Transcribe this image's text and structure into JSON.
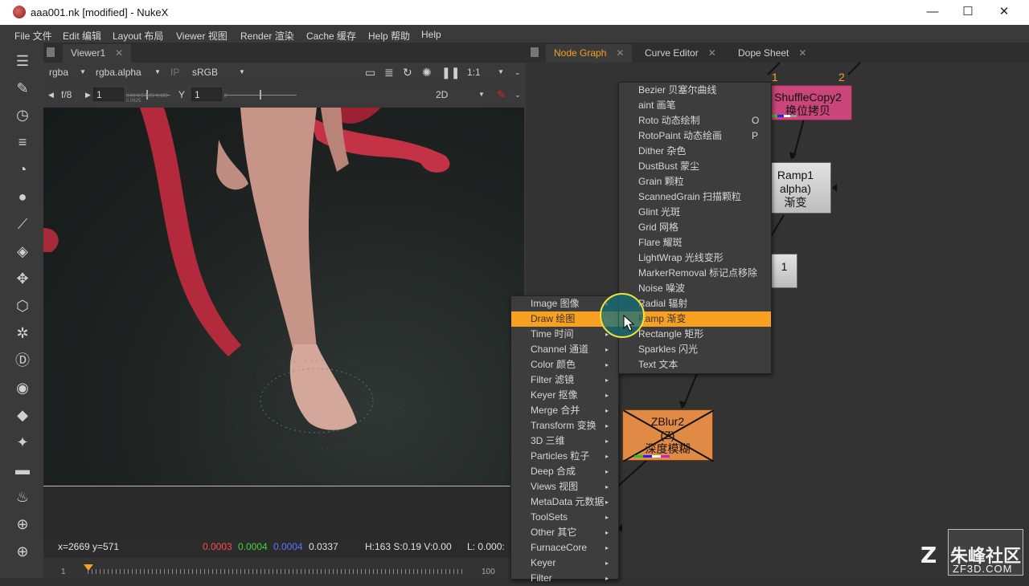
{
  "window": {
    "title": "aaa001.nk [modified] - NukeX",
    "min": "—",
    "max": "☐",
    "close": "✕"
  },
  "menubar": [
    "File 文件",
    "Edit 编辑",
    "Layout 布局",
    "Viewer 视图",
    "Render 渲染",
    "Cache 缓存",
    "Help 帮助",
    "Help"
  ],
  "viewer": {
    "tab": "Viewer1",
    "tab_close": "✕",
    "channels": "rgba",
    "layer": "rgba.alpha",
    "ip": "IP",
    "colorspace": "sRGB",
    "zoom": "1:1",
    "fstop": "f/8",
    "gain_value": "1",
    "gain_ticks": "0.01 0.5 0.25 0.125 0.0625",
    "y_label": "Y",
    "gamma_value": "1",
    "gamma_tick": "0",
    "view_mode": "2D",
    "status": {
      "coords": "x=2669 y=571",
      "r": "0.0003",
      "g": "0.0004",
      "b": "0.0004",
      "a": "0.0337",
      "hsv": "H:163 S:0.19 V:0.00",
      "l": "L: 0.000:"
    },
    "timeline": {
      "start": "1",
      "end": "100"
    }
  },
  "node_graph": {
    "tabs": [
      {
        "label": "Node Graph",
        "active": true
      },
      {
        "label": "Curve Editor",
        "active": false
      },
      {
        "label": "Dope Sheet",
        "active": false
      }
    ],
    "tab_close": "✕",
    "nodes": {
      "shuffle": {
        "line1": "ShuffleCopy2",
        "line2": "换位拷贝",
        "input1": "1",
        "input2": "2"
      },
      "ramp": {
        "line1": "Ramp1",
        "line2": "alpha)",
        "line3": "渐变"
      },
      "grey": {
        "line1": "1"
      },
      "zblur": {
        "line1": "ZBlur2",
        "line2": "(Z)",
        "line3": "深度模糊"
      }
    }
  },
  "toolbar_menu": {
    "items": [
      {
        "label": "Image 图像"
      },
      {
        "label": "Draw 绘图",
        "highlighted": true
      },
      {
        "label": "Time 时间"
      },
      {
        "label": "Channel 通道"
      },
      {
        "label": "Color 颜色"
      },
      {
        "label": "Filter 滤镜"
      },
      {
        "label": "Keyer 抠像"
      },
      {
        "label": "Merge 合并"
      },
      {
        "label": "Transform 变换"
      },
      {
        "label": "3D 三维"
      },
      {
        "label": "Particles 粒子"
      },
      {
        "label": "Deep 合成"
      },
      {
        "label": "Views 视图"
      },
      {
        "label": "MetaData 元数据"
      },
      {
        "label": "ToolSets"
      },
      {
        "label": "Other 其它"
      },
      {
        "label": "FurnaceCore"
      },
      {
        "label": "Keyer"
      },
      {
        "label": "Filter"
      }
    ],
    "arrow": "▸"
  },
  "draw_menu": {
    "items": [
      {
        "label": "Bezier 贝塞尔曲线",
        "shortcut": ""
      },
      {
        "label": "aint 画笔",
        "shortcut": ""
      },
      {
        "label": "Roto 动态绘制",
        "shortcut": "O"
      },
      {
        "label": "RotoPaint 动态绘画",
        "shortcut": "P"
      },
      {
        "label": "Dither 杂色",
        "shortcut": ""
      },
      {
        "label": "DustBust 蒙尘",
        "shortcut": ""
      },
      {
        "label": "Grain 颗粒",
        "shortcut": ""
      },
      {
        "label": "ScannedGrain 扫描颗粒",
        "shortcut": ""
      },
      {
        "label": "Glint 光斑",
        "shortcut": ""
      },
      {
        "label": "Grid 网格",
        "shortcut": ""
      },
      {
        "label": "Flare 耀斑",
        "shortcut": ""
      },
      {
        "label": "LightWrap 光线变形",
        "shortcut": ""
      },
      {
        "label": "MarkerRemoval 标记点移除",
        "shortcut": ""
      },
      {
        "label": "Noise 噪波",
        "shortcut": ""
      },
      {
        "label": "Radial 辐射",
        "shortcut": ""
      },
      {
        "label": "Ramp 渐变",
        "shortcut": "",
        "highlighted": true
      },
      {
        "label": "Rectangle 矩形",
        "shortcut": ""
      },
      {
        "label": "Sparkles 闪光",
        "shortcut": ""
      },
      {
        "label": "Text 文本",
        "shortcut": ""
      }
    ]
  },
  "watermark": {
    "brand": "朱峰社区",
    "url": "ZF3D.COM"
  },
  "colors": {
    "accent": "#f7a021",
    "shuffle_node": "#c9457a",
    "zblur_node": "#e08a46",
    "ramp_node": "#cfcfcf"
  },
  "icons": [
    "menu-icon",
    "brush-icon",
    "clock-icon",
    "channel-icon",
    "color-wheel-icon",
    "filter-icon",
    "keyer-icon",
    "merge-icon",
    "transform-icon",
    "3d-cube-icon",
    "particles-icon",
    "deep-icon",
    "eye-icon",
    "tag-icon",
    "wrench-icon",
    "layers-icon",
    "furnace-icon",
    "globe-icon"
  ]
}
